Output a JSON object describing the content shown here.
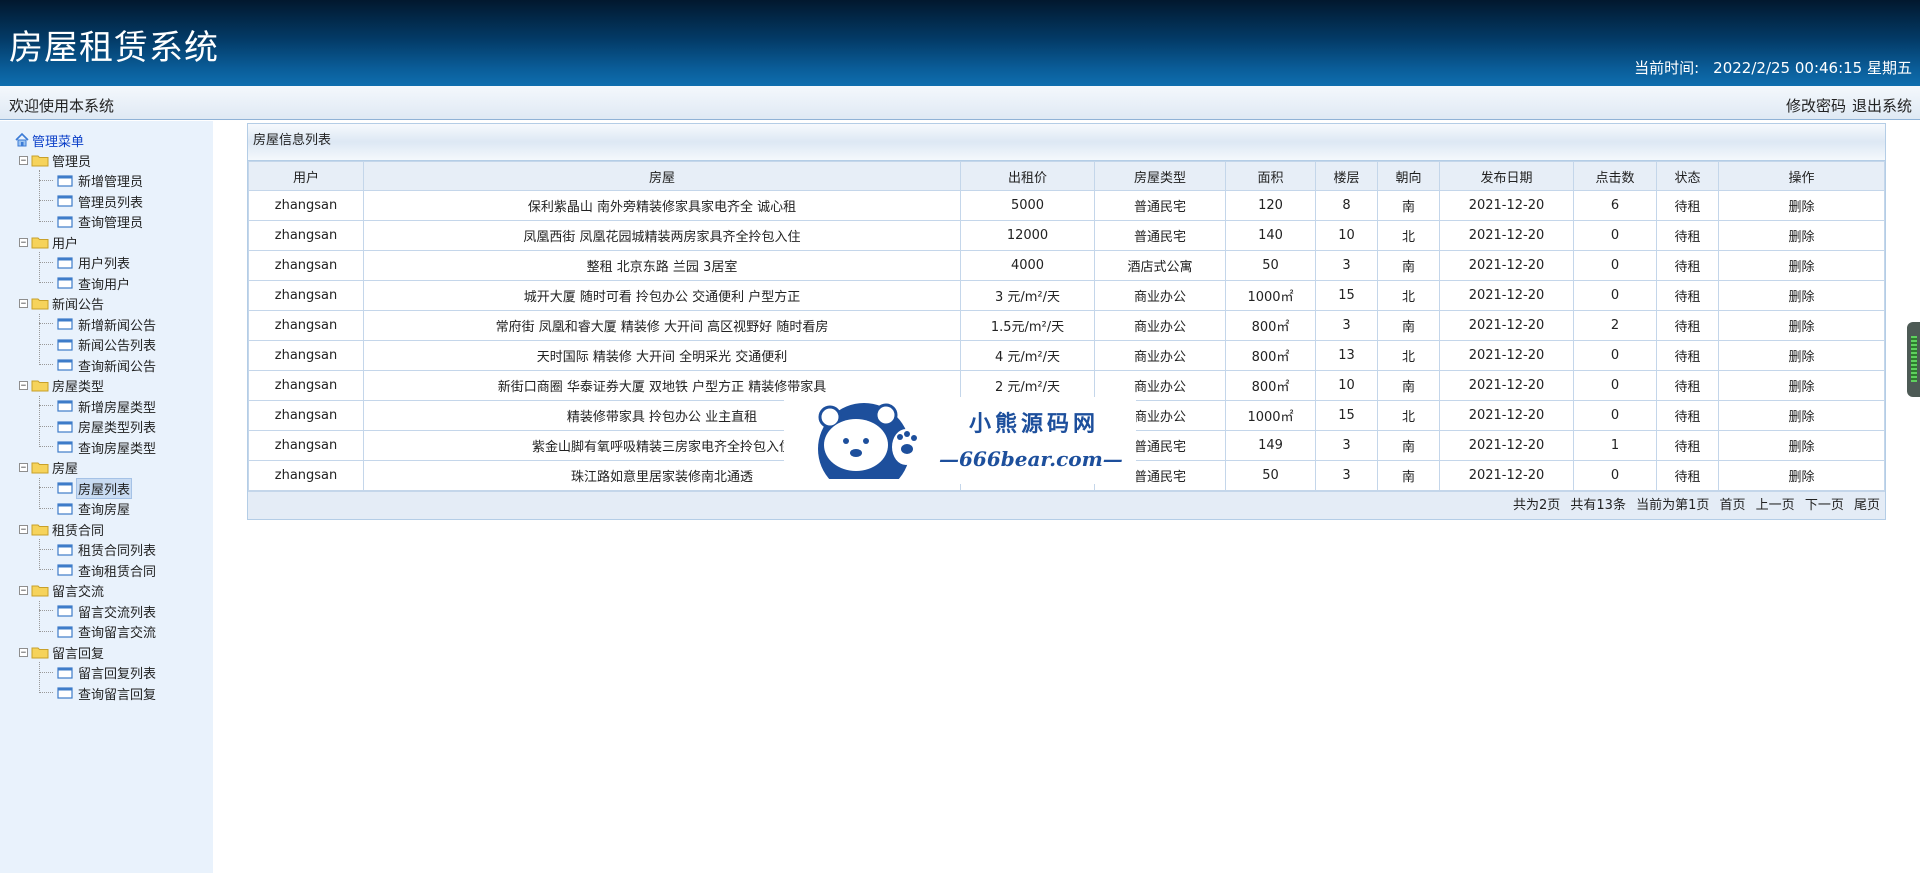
{
  "header": {
    "app_title": "房屋租赁系统",
    "clock_label": "当前时间:",
    "clock_value": "2022/2/25 00:46:15 星期五"
  },
  "welcome": {
    "text": "欢迎使用本系统",
    "change_password": "修改密码",
    "logout": "退出系统"
  },
  "sidebar": {
    "root": "管理菜单",
    "groups": [
      {
        "label": "管理员",
        "items": [
          "新增管理员",
          "管理员列表",
          "查询管理员"
        ]
      },
      {
        "label": "用户",
        "items": [
          "用户列表",
          "查询用户"
        ]
      },
      {
        "label": "新闻公告",
        "items": [
          "新增新闻公告",
          "新闻公告列表",
          "查询新闻公告"
        ]
      },
      {
        "label": "房屋类型",
        "items": [
          "新增房屋类型",
          "房屋类型列表",
          "查询房屋类型"
        ]
      },
      {
        "label": "房屋",
        "items": [
          "房屋列表",
          "查询房屋"
        ]
      },
      {
        "label": "租赁合同",
        "items": [
          "租赁合同列表",
          "查询租赁合同"
        ]
      },
      {
        "label": "留言交流",
        "items": [
          "留言交流列表",
          "查询留言交流"
        ]
      },
      {
        "label": "留言回复",
        "items": [
          "留言回复列表",
          "查询留言回复"
        ]
      }
    ],
    "active_item": "房屋列表"
  },
  "main": {
    "panel_title": "房屋信息列表",
    "columns": [
      "用户",
      "房屋",
      "出租价",
      "房屋类型",
      "面积",
      "楼层",
      "朝向",
      "发布日期",
      "点击数",
      "状态",
      "操作"
    ],
    "rows": [
      [
        "zhangsan",
        "保利紫晶山 南外旁精装修家具家电齐全 诚心租",
        "5000",
        "普通民宅",
        "120",
        "8",
        "南",
        "2021-12-20",
        "6",
        "待租",
        "删除"
      ],
      [
        "zhangsan",
        "凤凰西街 凤凰花园城精装两房家具齐全拎包入住",
        "12000",
        "普通民宅",
        "140",
        "10",
        "北",
        "2021-12-20",
        "0",
        "待租",
        "删除"
      ],
      [
        "zhangsan",
        "整租 北京东路 兰园 3居室",
        "4000",
        "酒店式公寓",
        "50",
        "3",
        "南",
        "2021-12-20",
        "0",
        "待租",
        "删除"
      ],
      [
        "zhangsan",
        "城开大厦 随时可看 拎包办公 交通便利 户型方正",
        "3 元/m²/天",
        "商业办公",
        "1000㎡",
        "15",
        "北",
        "2021-12-20",
        "0",
        "待租",
        "删除"
      ],
      [
        "zhangsan",
        "常府街 凤凰和睿大厦 精装修 大开间 高区视野好 随时看房",
        "1.5元/m²/天",
        "商业办公",
        "800㎡",
        "3",
        "南",
        "2021-12-20",
        "2",
        "待租",
        "删除"
      ],
      [
        "zhangsan",
        "天时国际 精装修 大开间 全明采光 交通便利",
        "4 元/m²/天",
        "商业办公",
        "800㎡",
        "13",
        "北",
        "2021-12-20",
        "0",
        "待租",
        "删除"
      ],
      [
        "zhangsan",
        "新街口商圈 华泰证券大厦 双地铁 户型方正 精装修带家具",
        "2 元/m²/天",
        "商业办公",
        "800㎡",
        "10",
        "南",
        "2021-12-20",
        "0",
        "待租",
        "删除"
      ],
      [
        "zhangsan",
        "精装修带家具 拎包办公 业主直租",
        "",
        "商业办公",
        "1000㎡",
        "15",
        "北",
        "2021-12-20",
        "0",
        "待租",
        "删除"
      ],
      [
        "zhangsan",
        "紫金山脚有氧呼吸精装三房家电齐全拎包入住",
        "",
        "普通民宅",
        "149",
        "3",
        "南",
        "2021-12-20",
        "1",
        "待租",
        "删除"
      ],
      [
        "zhangsan",
        "珠江路如意里居家装修南北通透",
        "",
        "普通民宅",
        "50",
        "3",
        "南",
        "2021-12-20",
        "0",
        "待租",
        "删除"
      ]
    ],
    "pager": {
      "total_pages": "共为2页",
      "total_items": "共有13条",
      "current_page": "当前为第1页",
      "first": "首页",
      "prev": "上一页",
      "next": "下一页",
      "last": "尾页"
    }
  },
  "watermark": {
    "title": "小熊源码网",
    "site": "—666bear.com—"
  },
  "icons": {
    "root": "home-icon",
    "group": "folder-icon",
    "item": "page-icon",
    "toggle": "collapse-icon"
  },
  "colors": {
    "header_dark": "#02182e",
    "header_light": "#0f6eaf",
    "sidebar_bg": "#e9f2fc",
    "grid_border": "#c4d6ea",
    "link_blue": "#0b3fc8",
    "watermark_blue": "#1d4f9c"
  }
}
